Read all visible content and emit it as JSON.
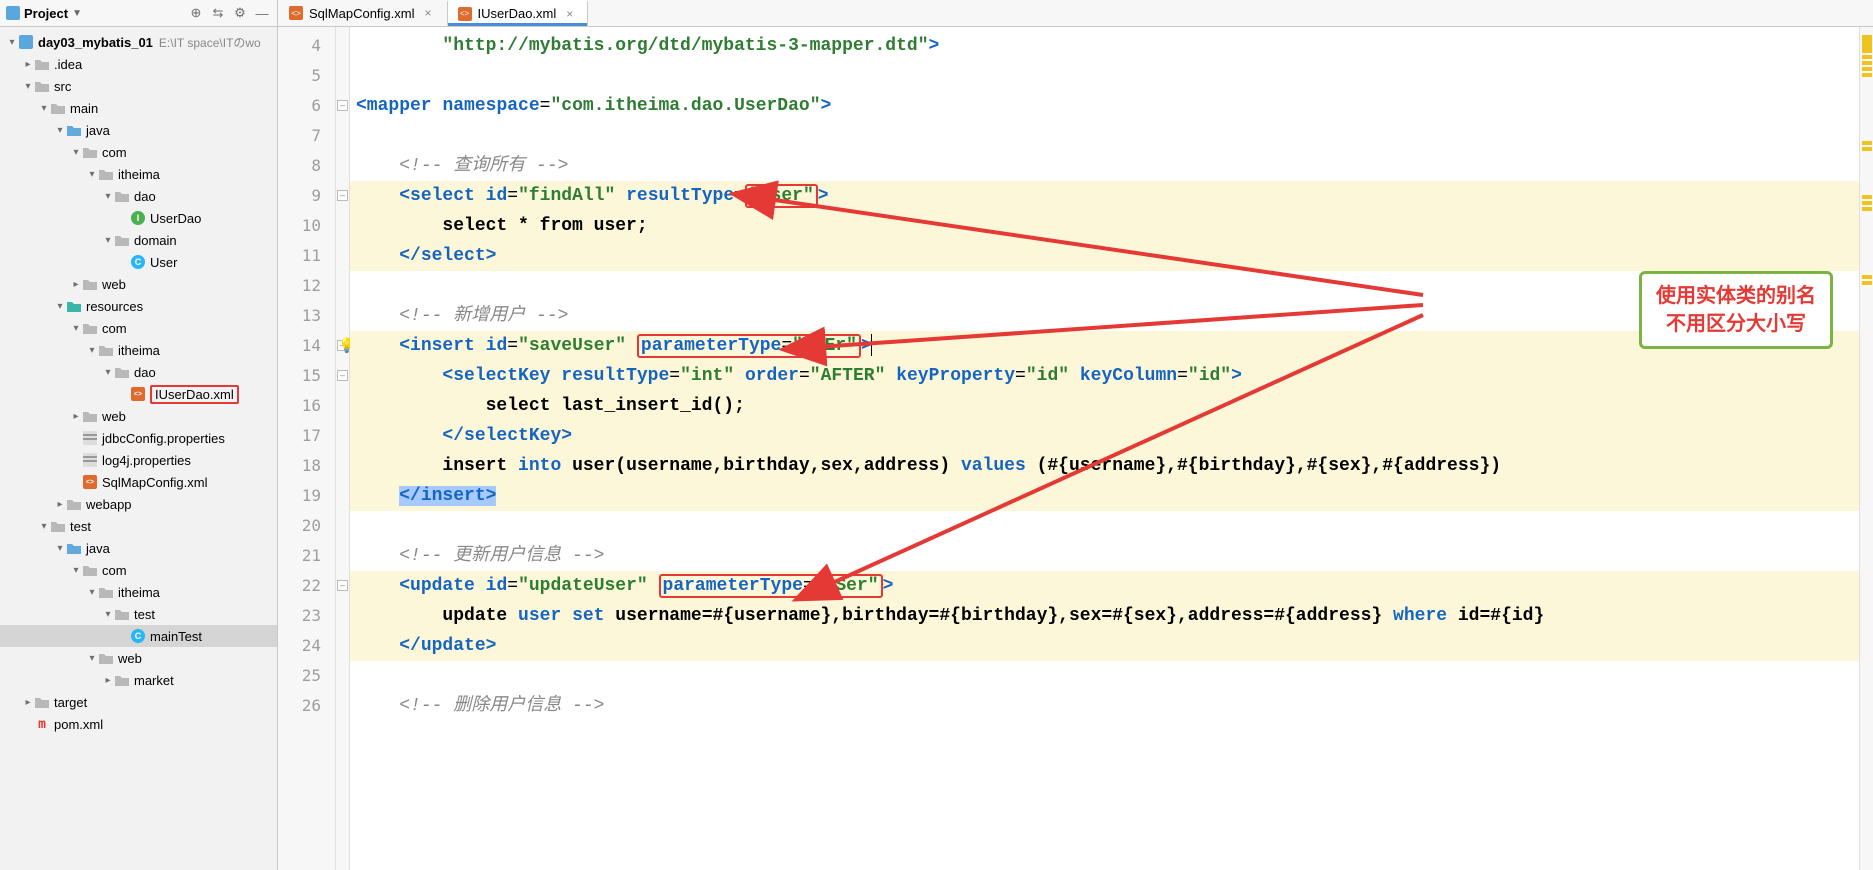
{
  "projectPanel": {
    "title": "Project",
    "tree": [
      {
        "depth": 0,
        "toggle": "▾",
        "icon": "module",
        "label": "day03_mybatis_01",
        "bold": true,
        "hint": "E:\\IT space\\ITのwo"
      },
      {
        "depth": 1,
        "toggle": "▸",
        "icon": "folder",
        "label": ".idea"
      },
      {
        "depth": 1,
        "toggle": "▾",
        "icon": "folder",
        "label": "src"
      },
      {
        "depth": 2,
        "toggle": "▾",
        "icon": "folder",
        "label": "main"
      },
      {
        "depth": 3,
        "toggle": "▾",
        "icon": "folder-blue",
        "label": "java"
      },
      {
        "depth": 4,
        "toggle": "▾",
        "icon": "folder",
        "label": "com"
      },
      {
        "depth": 5,
        "toggle": "▾",
        "icon": "folder",
        "label": "itheima"
      },
      {
        "depth": 6,
        "toggle": "▾",
        "icon": "folder",
        "label": "dao"
      },
      {
        "depth": 7,
        "toggle": "",
        "icon": "clsI",
        "label": "UserDao"
      },
      {
        "depth": 6,
        "toggle": "▾",
        "icon": "folder",
        "label": "domain"
      },
      {
        "depth": 7,
        "toggle": "",
        "icon": "clsC",
        "label": "User"
      },
      {
        "depth": 4,
        "toggle": "▸",
        "icon": "folder",
        "label": "web"
      },
      {
        "depth": 3,
        "toggle": "▾",
        "icon": "folder-teal",
        "label": "resources"
      },
      {
        "depth": 4,
        "toggle": "▾",
        "icon": "folder",
        "label": "com"
      },
      {
        "depth": 5,
        "toggle": "▾",
        "icon": "folder",
        "label": "itheima"
      },
      {
        "depth": 6,
        "toggle": "▾",
        "icon": "folder",
        "label": "dao"
      },
      {
        "depth": 7,
        "toggle": "",
        "icon": "xml",
        "label": "IUserDao.xml",
        "boxed": true
      },
      {
        "depth": 4,
        "toggle": "▸",
        "icon": "folder",
        "label": "web"
      },
      {
        "depth": 4,
        "toggle": "",
        "icon": "props",
        "label": "jdbcConfig.properties"
      },
      {
        "depth": 4,
        "toggle": "",
        "icon": "props",
        "label": "log4j.properties"
      },
      {
        "depth": 4,
        "toggle": "",
        "icon": "xml",
        "label": "SqlMapConfig.xml"
      },
      {
        "depth": 3,
        "toggle": "▸",
        "icon": "folder",
        "label": "webapp"
      },
      {
        "depth": 2,
        "toggle": "▾",
        "icon": "folder",
        "label": "test"
      },
      {
        "depth": 3,
        "toggle": "▾",
        "icon": "folder-blue",
        "label": "java"
      },
      {
        "depth": 4,
        "toggle": "▾",
        "icon": "folder",
        "label": "com"
      },
      {
        "depth": 5,
        "toggle": "▾",
        "icon": "folder",
        "label": "itheima"
      },
      {
        "depth": 6,
        "toggle": "▾",
        "icon": "folder",
        "label": "test"
      },
      {
        "depth": 7,
        "toggle": "",
        "icon": "clsC",
        "label": "mainTest",
        "selected": true
      },
      {
        "depth": 5,
        "toggle": "▾",
        "icon": "folder",
        "label": "web"
      },
      {
        "depth": 6,
        "toggle": "▸",
        "icon": "folder",
        "label": "market"
      },
      {
        "depth": 1,
        "toggle": "▸",
        "icon": "folder",
        "label": "target"
      },
      {
        "depth": 1,
        "toggle": "",
        "icon": "m",
        "label": "pom.xml"
      }
    ]
  },
  "tabs": [
    {
      "label": "SqlMapConfig.xml",
      "active": false
    },
    {
      "label": "IUserDao.xml",
      "active": true
    }
  ],
  "editor": {
    "firstLine": 4,
    "lines": [
      {
        "n": 4,
        "hl": false,
        "html": "        <span class='val'>\"http://mybatis.org/dtd/mybatis-3-mapper.dtd\"</span><span class='tag'>&gt;</span>"
      },
      {
        "n": 5,
        "hl": false,
        "html": ""
      },
      {
        "n": 6,
        "hl": false,
        "html": "<span class='tag'>&lt;mapper</span> <span class='attr'>namespace</span>=<span class='val'>\"com.itheima.dao.UserDao\"</span><span class='tag'>&gt;</span>"
      },
      {
        "n": 7,
        "hl": false,
        "html": ""
      },
      {
        "n": 8,
        "hl": false,
        "html": "    <span class='cmt'>&lt;!-- 查询所有 --&gt;</span>"
      },
      {
        "n": 9,
        "hl": true,
        "html": "    <span class='tag'>&lt;select</span> <span class='attr'>id</span>=<span class='val'>\"findAll\"</span> <span class='attr'>resultType</span>=<span class='red-box'><span class='val'>\"User\"</span></span><span class='tag'>&gt;</span>"
      },
      {
        "n": 10,
        "hl": true,
        "html": "        <span class='txt'>select * from user;</span>"
      },
      {
        "n": 11,
        "hl": true,
        "html": "    <span class='tag'>&lt;/select&gt;</span>"
      },
      {
        "n": 12,
        "hl": false,
        "html": ""
      },
      {
        "n": 13,
        "hl": false,
        "html": "    <span class='cmt'>&lt;!-- 新增用户 --&gt;</span>"
      },
      {
        "n": 14,
        "hl": true,
        "html": "    <span class='tag'>&lt;insert</span> <span class='attr'>id</span>=<span class='val'>\"saveUser\"</span> <span class='red-box'><span class='attr'>parameterType</span>=<span class='val'>\"UsEr\"</span></span><span class='tag'>&gt;</span><span class='caret'></span>"
      },
      {
        "n": 15,
        "hl": true,
        "html": "        <span class='tag'>&lt;selectKey</span> <span class='attr'>resultType</span>=<span class='val'>\"int\"</span> <span class='attr'>order</span>=<span class='val'>\"AFTER\"</span> <span class='attr'>keyProperty</span>=<span class='val'>\"id\"</span> <span class='attr'>keyColumn</span>=<span class='val'>\"id\"</span><span class='tag'>&gt;</span>"
      },
      {
        "n": 16,
        "hl": true,
        "html": "            <span class='txt'>select last_insert_id();</span>"
      },
      {
        "n": 17,
        "hl": true,
        "html": "        <span class='tag'>&lt;/selectKey&gt;</span>"
      },
      {
        "n": 18,
        "hl": true,
        "html": "        <span class='txt'>insert</span> <span class='kw'>into</span> <span class='txt'>user(username,birthday,sex,address)</span> <span class='kw'>values</span> <span class='txt'>(#{username},#{birthday},#{sex},#{address})</span>"
      },
      {
        "n": 19,
        "hl": true,
        "html": "    <span class='sel'><span class='tag'>&lt;/insert&gt;</span></span>"
      },
      {
        "n": 20,
        "hl": false,
        "html": ""
      },
      {
        "n": 21,
        "hl": false,
        "html": "    <span class='cmt'>&lt;!-- 更新用户信息 --&gt;</span>"
      },
      {
        "n": 22,
        "hl": true,
        "html": "    <span class='tag'>&lt;update</span> <span class='attr'>id</span>=<span class='val'>\"updateUser\"</span> <span class='red-box'><span class='attr'>parameterType</span>=<span class='val'>\"uSer\"</span></span><span class='tag'>&gt;</span>"
      },
      {
        "n": 23,
        "hl": true,
        "html": "        <span class='txt'>update</span> <span class='kw'>user</span> <span class='kw'>set</span> <span class='txt'>username=#{username},birthday=#{birthday},sex=#{sex},address=#{address}</span> <span class='kw'>where</span> <span class='txt'>id=#{id}</span>"
      },
      {
        "n": 24,
        "hl": true,
        "html": "    <span class='tag'>&lt;/update&gt;</span>"
      },
      {
        "n": 25,
        "hl": false,
        "html": ""
      },
      {
        "n": 26,
        "hl": false,
        "html": "    <span class='cmt'>&lt;!-- 删除用户信息 --&gt;</span>"
      }
    ]
  },
  "callout": {
    "line1": "使用实体类的别名",
    "line2": "不用区分大小写"
  }
}
